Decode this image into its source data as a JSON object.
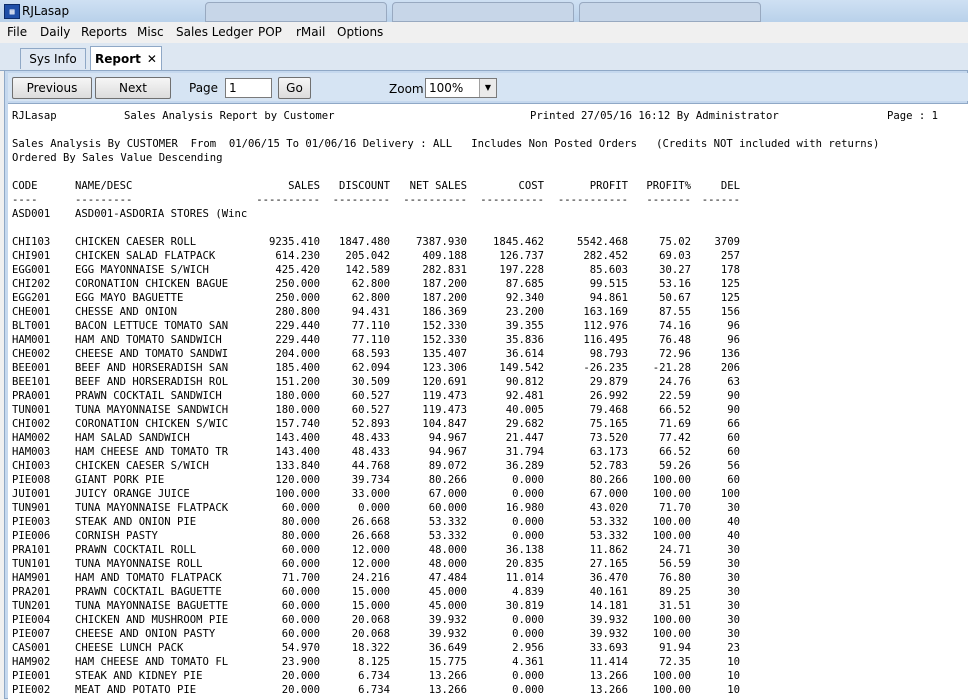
{
  "window": {
    "title": "RJLasap",
    "app_icon": "app-grid-icon"
  },
  "menu": [
    "File",
    "Daily",
    "Reports",
    "Misc",
    "Sales Ledger",
    "POP",
    "rMail",
    "Options"
  ],
  "tabs": {
    "inactive": "Sys Info",
    "active": "Report",
    "close": "✕"
  },
  "toolbar": {
    "previous": "Previous",
    "next": "Next",
    "page_label": "Page",
    "page_value": "1",
    "go": "Go",
    "zoom_label": "Zoom",
    "zoom_value": "100%"
  },
  "report": {
    "header_left": "RJLasap",
    "header_title": "Sales Analysis Report by Customer",
    "printed": "Printed 27/05/16 16:12 By Administrator",
    "page": "Page : 1",
    "criteria": "Sales Analysis By CUSTOMER  From  01/06/15 To 01/06/16 Delivery : ALL   Includes Non Posted Orders   (Credits NOT included with returns)",
    "ordered": "Ordered By Sales Value Descending",
    "columns": {
      "code": "CODE",
      "name": "NAME/DESC",
      "sales": "SALES",
      "discount": "DISCOUNT",
      "net_sales": "NET SALES",
      "cost": "COST",
      "profit": "PROFIT",
      "profit_pct": "PROFIT%",
      "del": "DEL"
    },
    "underline": {
      "code": "----",
      "name": "---------",
      "sales": "----------",
      "discount": "---------",
      "net_sales": "----------",
      "cost": "----------",
      "profit": "-----------",
      "profit_pct": "-------",
      "del": "------"
    },
    "customer": {
      "code": "ASD001",
      "name": "ASD001-ASDORIA STORES (Winc"
    },
    "rows": [
      [
        "CHI103",
        "CHICKEN CAESER ROLL",
        "9235.410",
        "1847.480",
        "7387.930",
        "1845.462",
        "5542.468",
        "75.02",
        "3709"
      ],
      [
        "CHI901",
        "CHICKEN SALAD FLATPACK",
        "614.230",
        "205.042",
        "409.188",
        "126.737",
        "282.452",
        "69.03",
        "257"
      ],
      [
        "EGG001",
        "EGG MAYONNAISE S/WICH",
        "425.420",
        "142.589",
        "282.831",
        "197.228",
        "85.603",
        "30.27",
        "178"
      ],
      [
        "CHI202",
        "CORONATION CHICKEN BAGUE",
        "250.000",
        "62.800",
        "187.200",
        "87.685",
        "99.515",
        "53.16",
        "125"
      ],
      [
        "EGG201",
        "EGG MAYO BAGUETTE",
        "250.000",
        "62.800",
        "187.200",
        "92.340",
        "94.861",
        "50.67",
        "125"
      ],
      [
        "CHE001",
        "CHESSE AND ONION",
        "280.800",
        "94.431",
        "186.369",
        "23.200",
        "163.169",
        "87.55",
        "156"
      ],
      [
        "BLT001",
        "BACON LETTUCE TOMATO SAN",
        "229.440",
        "77.110",
        "152.330",
        "39.355",
        "112.976",
        "74.16",
        "96"
      ],
      [
        "HAM001",
        "HAM AND TOMATO SANDWICH",
        "229.440",
        "77.110",
        "152.330",
        "35.836",
        "116.495",
        "76.48",
        "96"
      ],
      [
        "CHE002",
        "CHEESE AND TOMATO SANDWI",
        "204.000",
        "68.593",
        "135.407",
        "36.614",
        "98.793",
        "72.96",
        "136"
      ],
      [
        "BEE001",
        "BEEF AND HORSERADISH SAN",
        "185.400",
        "62.094",
        "123.306",
        "149.542",
        "-26.235",
        "-21.28",
        "206"
      ],
      [
        "BEE101",
        "BEEF AND HORSERADISH ROL",
        "151.200",
        "30.509",
        "120.691",
        "90.812",
        "29.879",
        "24.76",
        "63"
      ],
      [
        "PRA001",
        "PRAWN COCKTAIL SANDWICH",
        "180.000",
        "60.527",
        "119.473",
        "92.481",
        "26.992",
        "22.59",
        "90"
      ],
      [
        "TUN001",
        "TUNA MAYONNAISE SANDWICH",
        "180.000",
        "60.527",
        "119.473",
        "40.005",
        "79.468",
        "66.52",
        "90"
      ],
      [
        "CHI002",
        "CORONATION CHICKEN S/WIC",
        "157.740",
        "52.893",
        "104.847",
        "29.682",
        "75.165",
        "71.69",
        "66"
      ],
      [
        "HAM002",
        "HAM SALAD SANDWICH",
        "143.400",
        "48.433",
        "94.967",
        "21.447",
        "73.520",
        "77.42",
        "60"
      ],
      [
        "HAM003",
        "HAM CHEESE AND TOMATO TR",
        "143.400",
        "48.433",
        "94.967",
        "31.794",
        "63.173",
        "66.52",
        "60"
      ],
      [
        "CHI003",
        "CHICKEN CAESER S/WICH",
        "133.840",
        "44.768",
        "89.072",
        "36.289",
        "52.783",
        "59.26",
        "56"
      ],
      [
        "PIE008",
        "GIANT PORK PIE",
        "120.000",
        "39.734",
        "80.266",
        "0.000",
        "80.266",
        "100.00",
        "60"
      ],
      [
        "JUI001",
        "JUICY ORANGE JUICE",
        "100.000",
        "33.000",
        "67.000",
        "0.000",
        "67.000",
        "100.00",
        "100"
      ],
      [
        "TUN901",
        "TUNA MAYONNAISE FLATPACK",
        "60.000",
        "0.000",
        "60.000",
        "16.980",
        "43.020",
        "71.70",
        "30"
      ],
      [
        "PIE003",
        "STEAK AND ONION PIE",
        "80.000",
        "26.668",
        "53.332",
        "0.000",
        "53.332",
        "100.00",
        "40"
      ],
      [
        "PIE006",
        "CORNISH PASTY",
        "80.000",
        "26.668",
        "53.332",
        "0.000",
        "53.332",
        "100.00",
        "40"
      ],
      [
        "PRA101",
        "PRAWN COCKTAIL ROLL",
        "60.000",
        "12.000",
        "48.000",
        "36.138",
        "11.862",
        "24.71",
        "30"
      ],
      [
        "TUN101",
        "TUNA MAYONNAISE ROLL",
        "60.000",
        "12.000",
        "48.000",
        "20.835",
        "27.165",
        "56.59",
        "30"
      ],
      [
        "HAM901",
        "HAM AND TOMATO FLATPACK",
        "71.700",
        "24.216",
        "47.484",
        "11.014",
        "36.470",
        "76.80",
        "30"
      ],
      [
        "PRA201",
        "PRAWN COCKTAIL BAGUETTE",
        "60.000",
        "15.000",
        "45.000",
        "4.839",
        "40.161",
        "89.25",
        "30"
      ],
      [
        "TUN201",
        "TUNA MAYONNAISE BAGUETTE",
        "60.000",
        "15.000",
        "45.000",
        "30.819",
        "14.181",
        "31.51",
        "30"
      ],
      [
        "PIE004",
        "CHICKEN AND MUSHROOM PIE",
        "60.000",
        "20.068",
        "39.932",
        "0.000",
        "39.932",
        "100.00",
        "30"
      ],
      [
        "PIE007",
        "CHEESE AND ONION PASTY",
        "60.000",
        "20.068",
        "39.932",
        "0.000",
        "39.932",
        "100.00",
        "30"
      ],
      [
        "CAS001",
        "CHEESE LUNCH PACK",
        "54.970",
        "18.322",
        "36.649",
        "2.956",
        "33.693",
        "91.94",
        "23"
      ],
      [
        "HAM902",
        "HAM CHEESE AND TOMATO FL",
        "23.900",
        "8.125",
        "15.775",
        "4.361",
        "11.414",
        "72.35",
        "10"
      ],
      [
        "PIE001",
        "STEAK AND KIDNEY PIE",
        "20.000",
        "6.734",
        "13.266",
        "0.000",
        "13.266",
        "100.00",
        "10"
      ],
      [
        "PIE002",
        "MEAT AND POTATO PIE",
        "20.000",
        "6.734",
        "13.266",
        "0.000",
        "13.266",
        "100.00",
        "10"
      ]
    ]
  }
}
